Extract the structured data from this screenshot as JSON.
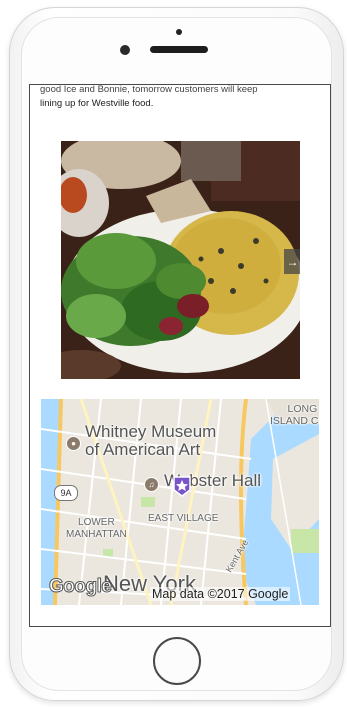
{
  "article": {
    "partial_line": "good Ice and Bonnie, tomorrow customers will keep",
    "last_line": "lining up for Westville food."
  },
  "gallery": {
    "next_arrow": "→"
  },
  "map": {
    "labels": {
      "museum": "Whitney Museum of American Art",
      "webster": "Webster Hall",
      "lic_line1": "LONG",
      "lic_line2": "ISLAND CITY",
      "lower_line1": "LOWER",
      "lower_line2": "MANHATTAN",
      "east_village": "EAST VILLAGE",
      "kent": "Kent Ave",
      "nyc": "New York",
      "route": "9A"
    },
    "logo": "Google",
    "attribution": "Map data ©2017 Google"
  },
  "colors": {
    "water": "#aadaff",
    "park": "#c8e6a8",
    "highway": "#f8c860",
    "marker": "#7a55c9"
  }
}
